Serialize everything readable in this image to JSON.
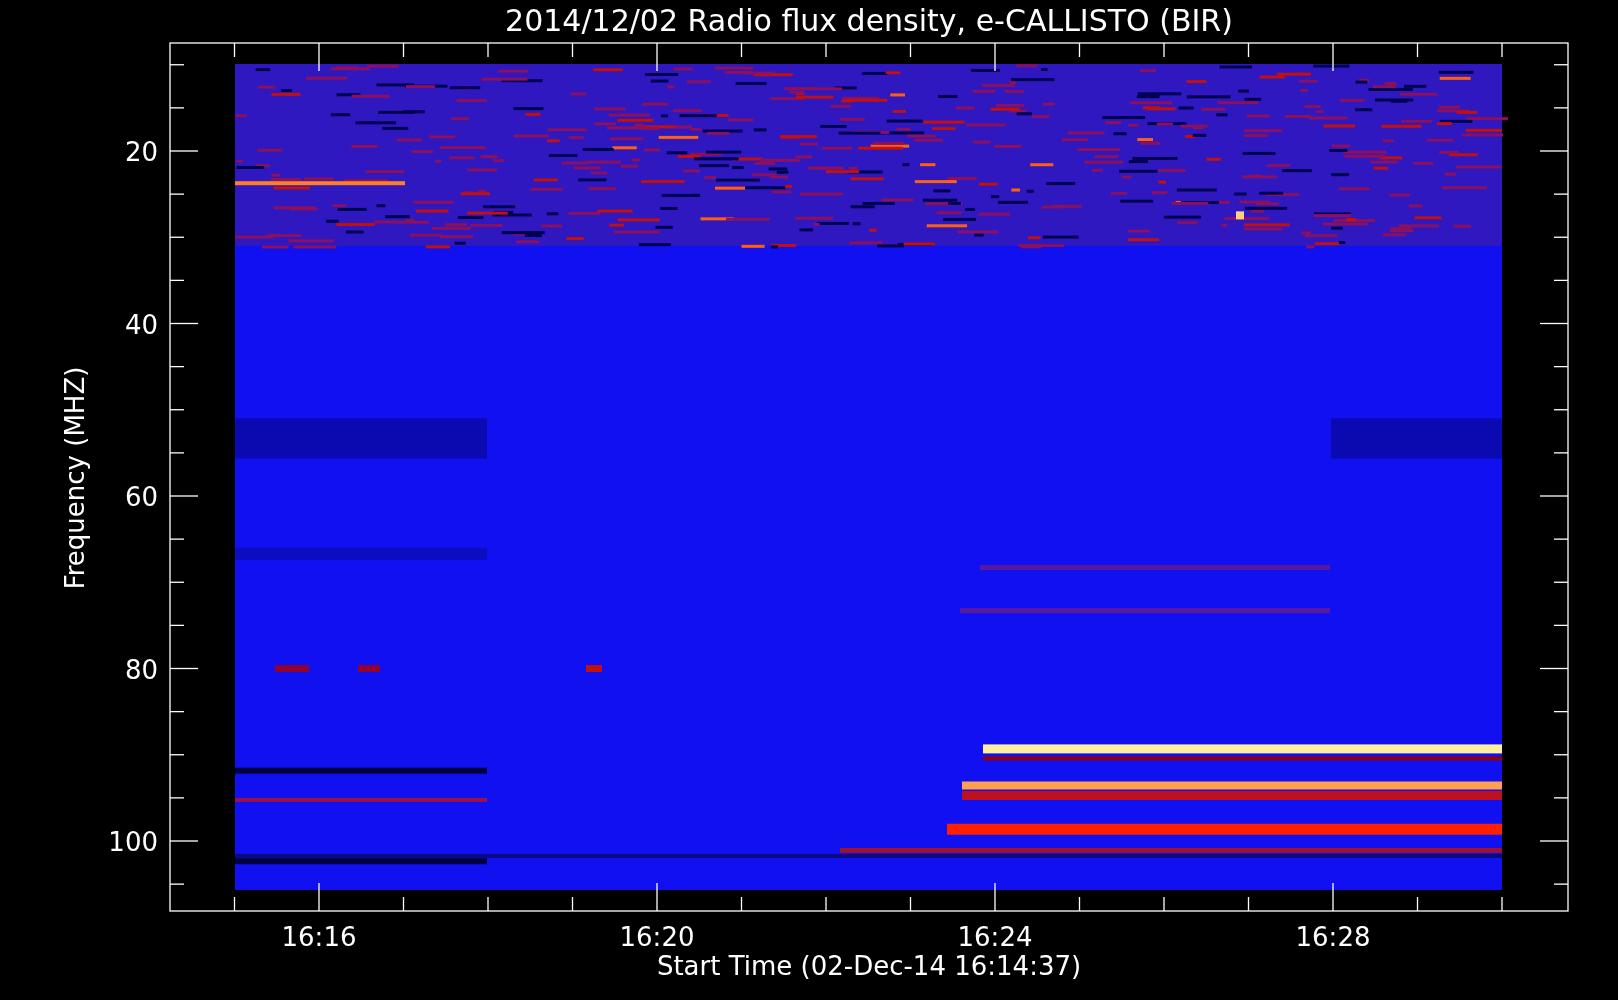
{
  "title": "2014/12/02  Radio flux density, e-CALLISTO (BIR)",
  "y_axis": {
    "label": "Frequency (MHZ)",
    "ticks": [
      "20",
      "40",
      "60",
      "80",
      "100"
    ]
  },
  "x_axis": {
    "label": "Start Time (02-Dec-14 16:14:37)",
    "ticks": [
      "16:16",
      "16:20",
      "16:24",
      "16:28"
    ]
  }
}
